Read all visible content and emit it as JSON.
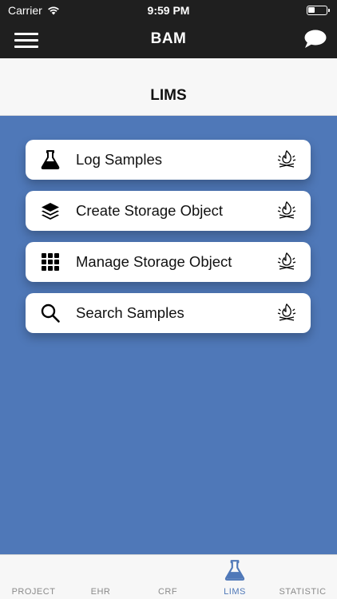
{
  "status_bar": {
    "carrier": "Carrier",
    "time": "9:59 PM"
  },
  "nav": {
    "title": "BAM"
  },
  "section": {
    "title": "LIMS"
  },
  "menu_items": [
    {
      "label": "Log Samples",
      "icon": "flask-icon"
    },
    {
      "label": "Create Storage Object",
      "icon": "layers-icon"
    },
    {
      "label": "Manage Storage Object",
      "icon": "grid-icon"
    },
    {
      "label": "Search Samples",
      "icon": "search-icon"
    }
  ],
  "tabs": [
    {
      "label": "PROJECT",
      "active": false
    },
    {
      "label": "EHR",
      "active": false
    },
    {
      "label": "CRF",
      "active": false
    },
    {
      "label": "LIMS",
      "active": true,
      "icon": "flask-icon"
    },
    {
      "label": "STATISTIC",
      "active": false
    }
  ],
  "colors": {
    "background": "#4f78b8",
    "dark_bar": "#1f1f1f",
    "active_tab": "#4f78b8"
  }
}
